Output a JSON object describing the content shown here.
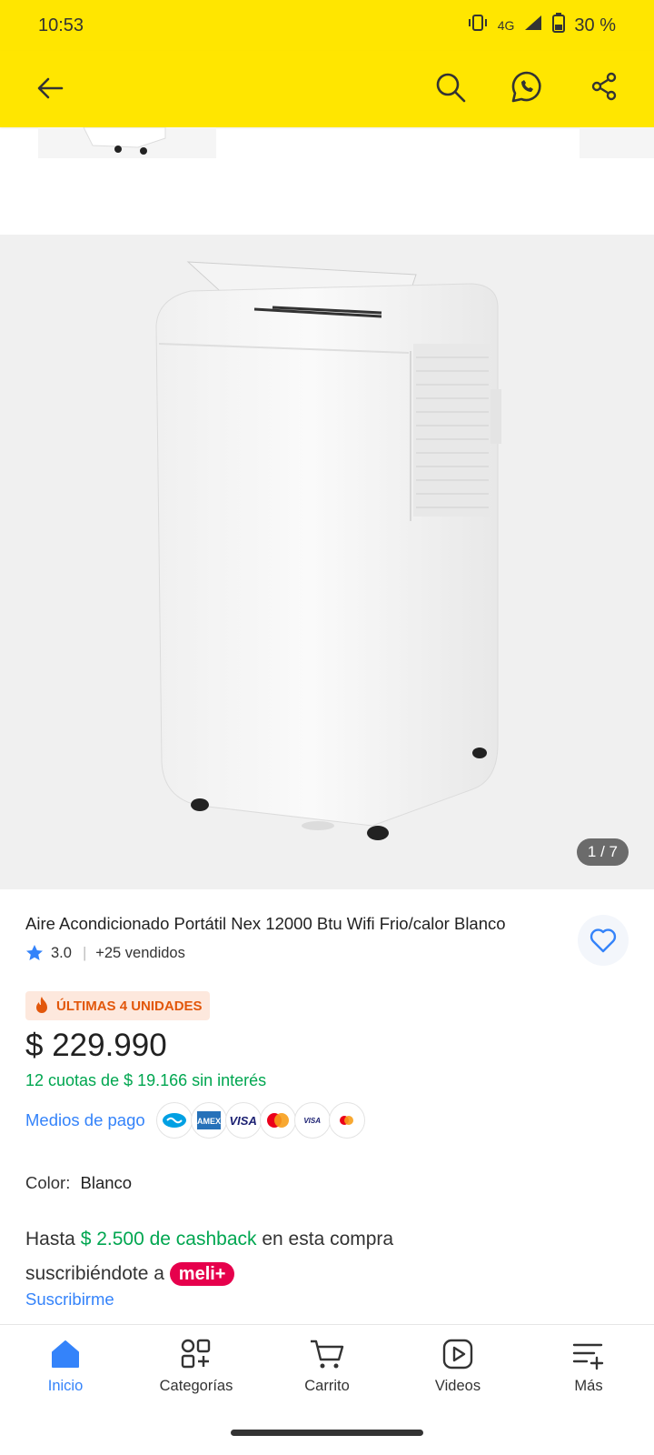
{
  "status": {
    "time": "10:53",
    "network": "4G",
    "battery": "30 %"
  },
  "gallery": {
    "counter": "1 / 7"
  },
  "product": {
    "title": "Aire Acondicionado Portátil Nex 12000 Btu Wifi Frio/calor Blanco",
    "rating": "3.0",
    "sold": "+25 vendidos",
    "badge": "ÚLTIMAS 4 UNIDADES",
    "price": "$ 229.990",
    "installments": "12 cuotas de $ 19.166  sin interés",
    "payment_label": "Medios de pago",
    "payment_methods": [
      "mercadopago",
      "amex",
      "visa",
      "mastercard",
      "visa-debit",
      "mastercard-debit"
    ],
    "color_label": "Color:",
    "color_value": "Blanco",
    "cashback_prefix": "Hasta",
    "cashback_amount": "$ 2.500 de cashback",
    "cashback_suffix": "en esta compra",
    "cashback_line2": "suscribiéndote a",
    "meli_plus": "meli+",
    "subscribe_link": "Suscribirme"
  },
  "nav": [
    {
      "label": "Inicio",
      "icon": "home-icon",
      "active": true
    },
    {
      "label": "Categorías",
      "icon": "categories-icon"
    },
    {
      "label": "Carrito",
      "icon": "cart-icon"
    },
    {
      "label": "Videos",
      "icon": "videos-icon"
    },
    {
      "label": "Más",
      "icon": "more-icon"
    }
  ],
  "colors": {
    "brand_yellow": "#ffe600",
    "link_blue": "#3483fa",
    "success_green": "#00a650",
    "badge_orange": "#e2570b"
  }
}
